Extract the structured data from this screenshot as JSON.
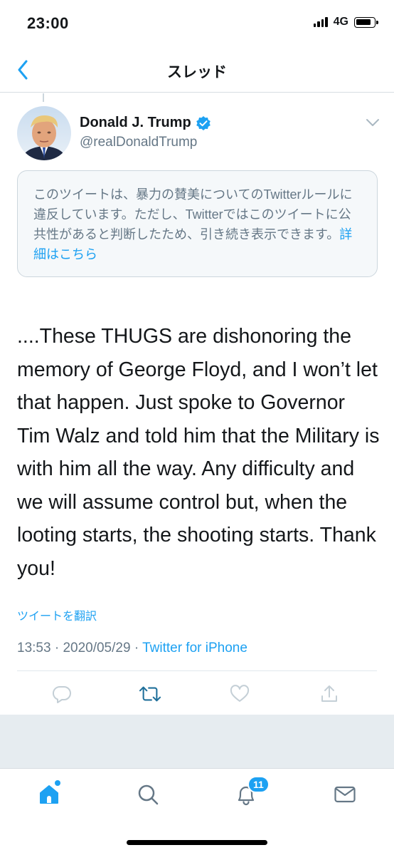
{
  "status_bar": {
    "time": "23:00",
    "network": "4G",
    "signal_icon": "cellular-signal-icon",
    "battery_icon": "battery-icon"
  },
  "nav": {
    "back_icon": "chevron-left-icon",
    "title": "スレッド"
  },
  "tweet": {
    "author_name": "Donald J. Trump",
    "verified_icon": "verified-badge-icon",
    "handle": "@realDonaldTrump",
    "menu_icon": "chevron-down-icon",
    "notice_text": "このツイートは、暴力の賛美についてのTwitterルールに違反しています。ただし、Twitterではこのツイートに公共性があると判断したため、引き続き表示できます。",
    "notice_link": "詳細はこちら",
    "text": "....These THUGS are dishonoring the memory of George Floyd, and I won’t let that happen. Just spoke to Governor Tim Walz and told him that the Military is with him all the way. Any difficulty and we will assume control but, when the looting starts, the shooting starts. Thank you!",
    "translate_label": "ツイートを翻訳",
    "time": "13:53",
    "date": "2020/05/29",
    "separator": "·",
    "source": "Twitter for iPhone",
    "actions": [
      "reply-icon",
      "retweet-icon",
      "like-icon",
      "share-icon"
    ]
  },
  "tab_bar": {
    "tabs": [
      "home-icon",
      "search-icon",
      "notifications-icon",
      "messages-icon"
    ],
    "notification_count": "11"
  },
  "colors": {
    "accent": "#1da1f2",
    "secondary_text": "#657786",
    "notice_bg": "#f5f8fa",
    "gray_area": "#e6ecf0"
  }
}
